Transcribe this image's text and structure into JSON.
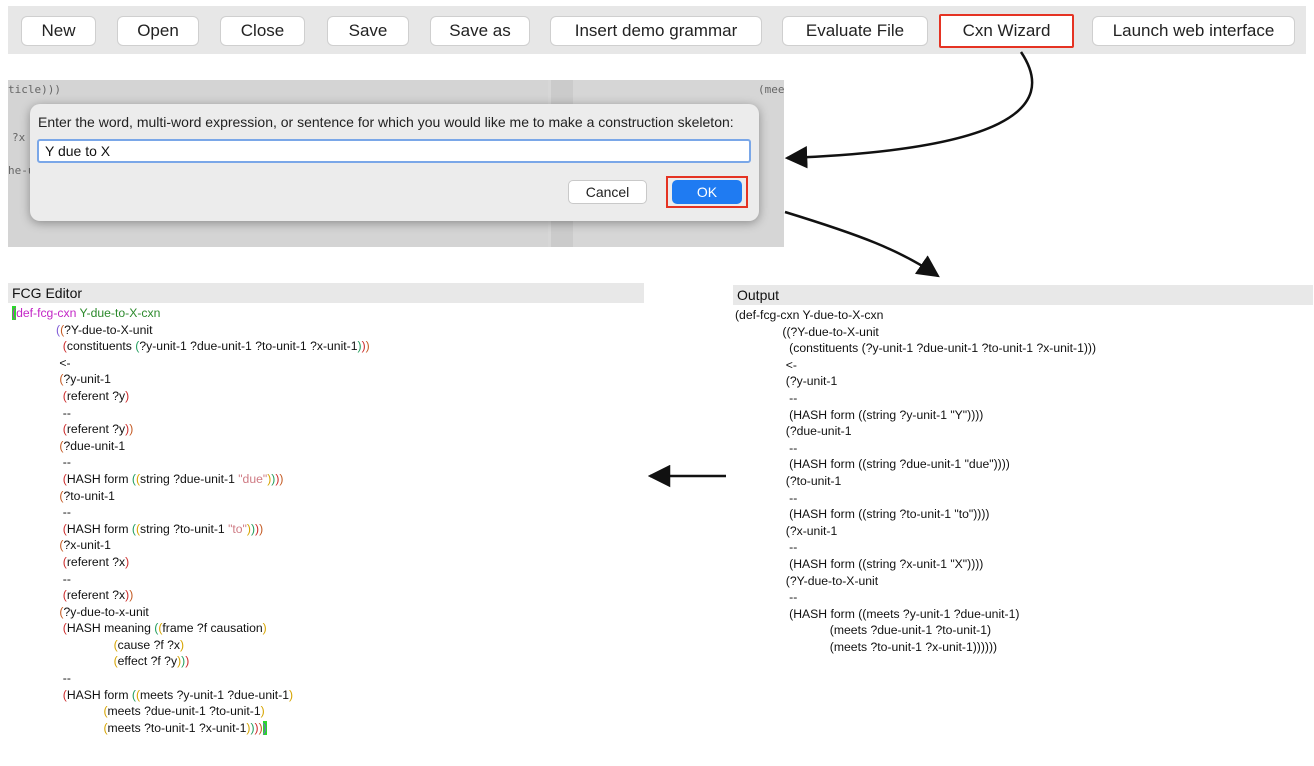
{
  "toolbar": {
    "buttons": [
      "New",
      "Open",
      "Close",
      "Save",
      "Save as",
      "Insert demo grammar",
      "Evaluate File",
      "Cxn Wizard",
      "Launch web interface"
    ]
  },
  "dialog": {
    "prompt": "Enter the word, multi-word expression, or sentence for which you would like me to make a construction skeleton:",
    "value": "Y due to X",
    "cancel_label": "Cancel",
    "ok_label": "OK",
    "background_fragments": [
      "ticle)))",
      "?x",
      "he-u",
      "(mee"
    ]
  },
  "editor": {
    "title": "FCG Editor",
    "code": [
      "(def-fcg-cxn Y-due-to-X-cxn",
      "             ((?Y-due-to-X-unit",
      "               (constituents (?y-unit-1 ?due-unit-1 ?to-unit-1 ?x-unit-1)))",
      "              <-",
      "              (?y-unit-1",
      "               (referent ?y)",
      "               --",
      "               (referent ?y))",
      "              (?due-unit-1",
      "               --",
      "               (HASH form ((string ?due-unit-1 \"due\"))))",
      "              (?to-unit-1",
      "               --",
      "               (HASH form ((string ?to-unit-1 \"to\"))))",
      "              (?x-unit-1",
      "               (referent ?x)",
      "               --",
      "               (referent ?x))",
      "              (?y-due-to-x-unit",
      "               (HASH meaning ((frame ?f causation)",
      "                              (cause ?f ?x)",
      "                              (effect ?f ?y)))",
      "               --",
      "               (HASH form ((meets ?y-unit-1 ?due-unit-1)",
      "                           (meets ?due-unit-1 ?to-unit-1)",
      "                           (meets ?to-unit-1 ?x-unit-1)))))"
    ]
  },
  "output": {
    "title": "Output",
    "code": [
      "(def-fcg-cxn Y-due-to-X-cxn",
      "              ((?Y-due-to-X-unit",
      "                (constituents (?y-unit-1 ?due-unit-1 ?to-unit-1 ?x-unit-1)))",
      "               <-",
      "               (?y-unit-1",
      "                --",
      "                (HASH form ((string ?y-unit-1 \"Y\"))))",
      "               (?due-unit-1",
      "                --",
      "                (HASH form ((string ?due-unit-1 \"due\"))))",
      "               (?to-unit-1",
      "                --",
      "                (HASH form ((string ?to-unit-1 \"to\"))))",
      "               (?x-unit-1",
      "                --",
      "                (HASH form ((string ?x-unit-1 \"X\"))))",
      "               (?Y-due-to-X-unit",
      "                --",
      "                (HASH form ((meets ?y-unit-1 ?due-unit-1)",
      "                            (meets ?due-unit-1 ?to-unit-1)",
      "                            (meets ?to-unit-1 ?x-unit-1))))))"
    ]
  },
  "colors": {
    "highlight": "#e53323",
    "ok_button": "#1f7bf2",
    "cursor": "#2ad82a"
  }
}
